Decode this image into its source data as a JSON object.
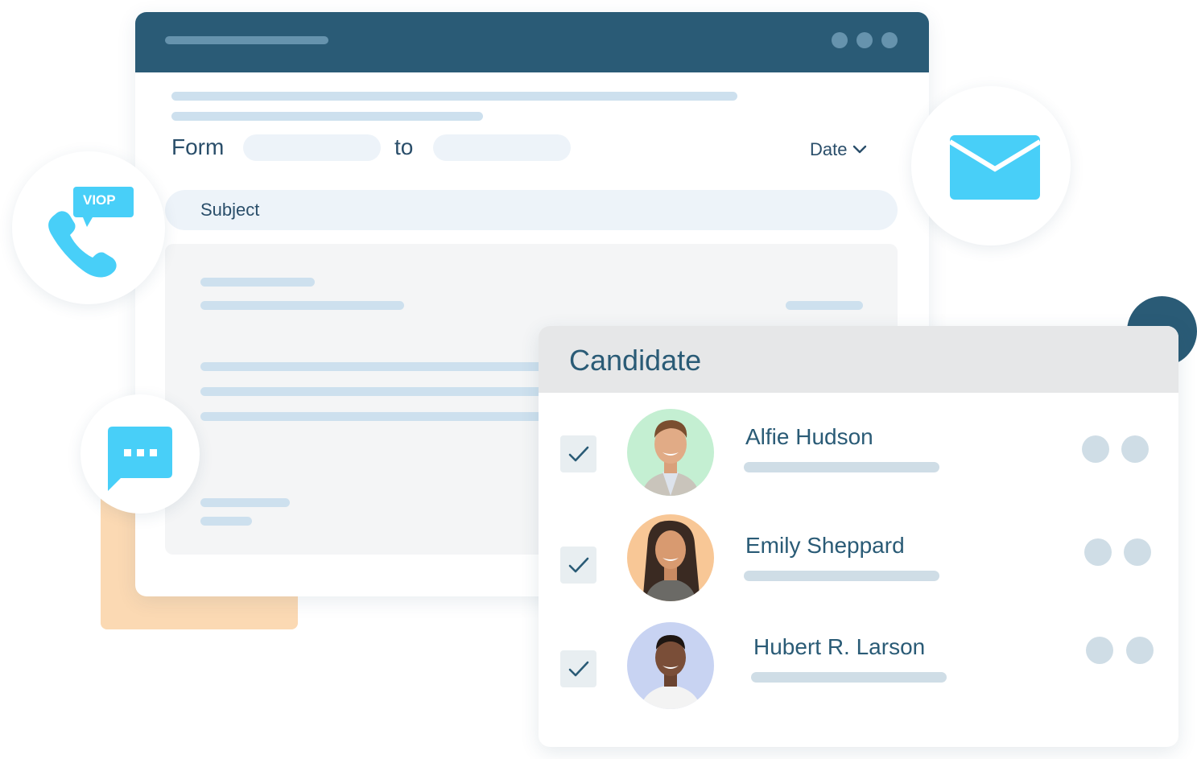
{
  "colors": {
    "titlebar": "#2a5b76",
    "accent_blue": "#48cff8",
    "placeholder_bar": "#cde0ee",
    "peach": "#fbd9b3",
    "text_dark": "#2a5b76"
  },
  "email_form": {
    "from_label": "Form",
    "to_label": "to",
    "date_label": "Date",
    "date_icon": "chevron-down-icon",
    "subject_placeholder": "Subject",
    "from_value": "",
    "to_value": ""
  },
  "badges": {
    "voip_label": "VIOP",
    "voip_icon": "phone-icon",
    "chat_icon": "chat-bubble-icon",
    "email_icon": "envelope-icon"
  },
  "candidate_card": {
    "title": "Candidate",
    "candidates": [
      {
        "name": "Alfie Hudson",
        "checked": true,
        "avatar_bg": "#c4efd2"
      },
      {
        "name": "Emily Sheppard",
        "checked": true,
        "avatar_bg": "#f8c796"
      },
      {
        "name": "Hubert R. Larson",
        "checked": true,
        "avatar_bg": "#c8d3f2"
      }
    ]
  }
}
